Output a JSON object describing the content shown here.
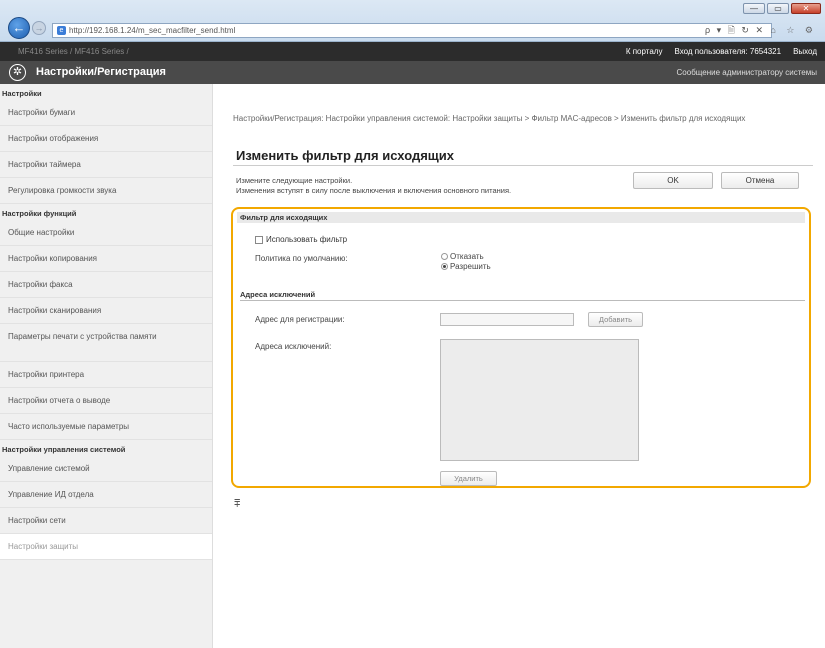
{
  "browser": {
    "url": "http://192.168.1.24/m_sec_macfilter_send.html",
    "search_hint": "ρ ▾ 🗎 ↻ ✕",
    "tab_icons": "⌂ ☆ ⚙",
    "window_controls": {
      "minimize": "—",
      "restore": "▭",
      "close": "✕"
    }
  },
  "topbar": {
    "device_name": "MF416 Series / MF416 Series /",
    "portal_link": "К порталу",
    "login_label": "Вход пользователя:",
    "user_id": "7654321",
    "logout": "Выход"
  },
  "header": {
    "title": "Настройки/Регистрация",
    "admin_message": "Сообщение администратору системы"
  },
  "sidebar": {
    "groups": [
      {
        "heading": "Настройки",
        "items": [
          "Настройки бумаги",
          "Настройки отображения",
          "Настройки таймера",
          "Регулировка громкости звука"
        ]
      },
      {
        "heading": "Настройки функций",
        "items": [
          "Общие настройки",
          "Настройки копирования",
          "Настройки факса",
          "Настройки сканирования",
          "Параметры печати с устройства памяти",
          "Настройки принтера",
          "Настройки отчета о выводе",
          "Часто используемые параметры"
        ]
      },
      {
        "heading": "Настройки управления системой",
        "items": [
          "Управление системой",
          "Управление ИД отдела",
          "Настройки сети",
          "Настройки защиты"
        ]
      }
    ]
  },
  "main": {
    "breadcrumb": "Настройки/Регистрация: Настройки управления системой: Настройки защиты > Фильтр MAC-адресов > Изменить фильтр для исходящих",
    "title": "Изменить фильтр для исходящих",
    "desc_line1": "Измените следующие настройки.",
    "desc_line2": "Изменения вступят в силу после выключения и включения основного питания.",
    "ok_label": "OK",
    "cancel_label": "Отмена",
    "section_title": "Фильтр для исходящих",
    "use_filter_label": "Использовать фильтр",
    "default_policy_label": "Политика по умолчанию:",
    "policy_options": [
      "Отказать",
      "Разрешить"
    ],
    "policy_selected": "Разрешить",
    "exceptions_heading": "Адреса исключений",
    "register_label": "Адрес для регистрации:",
    "add_label": "Добавить",
    "exception_list_label": "Адреса исключений:",
    "delete_label": "Удалить",
    "to_top_icon": "⩱"
  }
}
